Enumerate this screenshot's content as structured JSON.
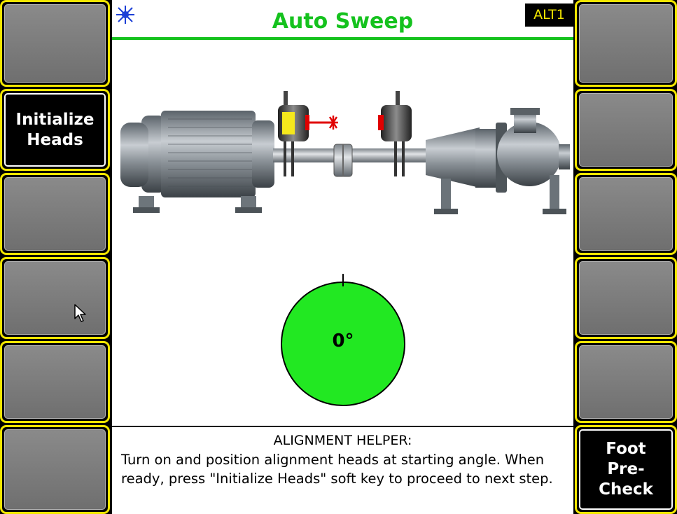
{
  "header": {
    "title": "Auto Sweep",
    "badge": "ALT1",
    "title_color": "#15c21e",
    "badge_text_color": "#f2e600"
  },
  "softkeys": {
    "left": [
      {
        "label": ""
      },
      {
        "label": "Initialize\nHeads"
      },
      {
        "label": ""
      },
      {
        "label": ""
      },
      {
        "label": ""
      },
      {
        "label": ""
      }
    ],
    "right": [
      {
        "label": ""
      },
      {
        "label": ""
      },
      {
        "label": ""
      },
      {
        "label": ""
      },
      {
        "label": ""
      },
      {
        "label": "Foot\nPre-\nCheck"
      }
    ]
  },
  "dial": {
    "angle_label": "0°",
    "color": "#22e822"
  },
  "helper": {
    "title": "ALIGNMENT HELPER:",
    "text": "Turn on and position alignment heads at starting angle. When ready, press \"Initialize Heads\" soft key to proceed to next step."
  },
  "icons": {
    "status": "laser-sun-icon",
    "cursor": "mouse-pointer-icon"
  },
  "colors": {
    "softkey_border": "#f2e600",
    "laser": "#e00000"
  }
}
